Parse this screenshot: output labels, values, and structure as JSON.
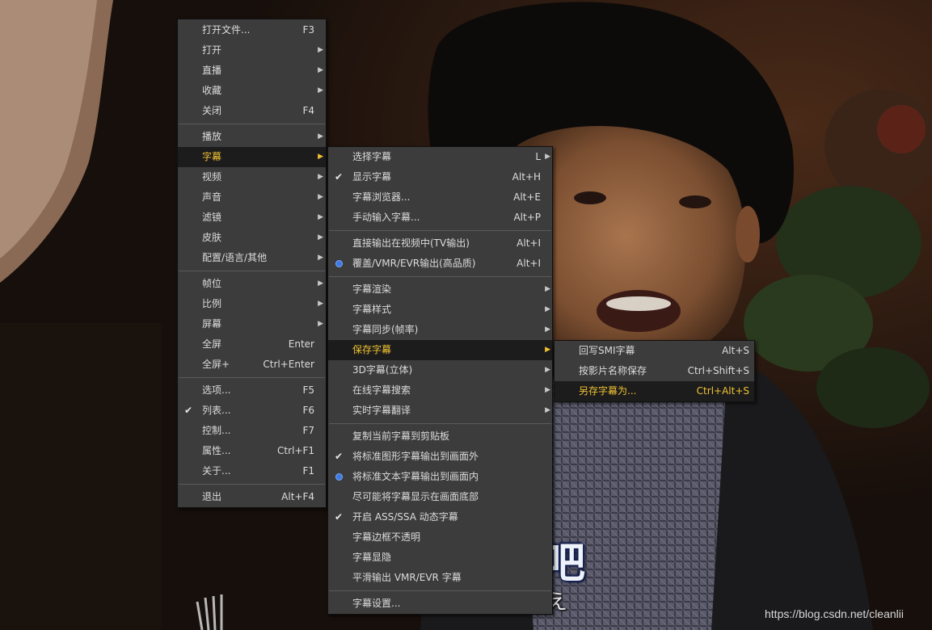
{
  "menu_main": {
    "items": [
      {
        "label": "打开文件...",
        "shortcut": "F3"
      },
      {
        "label": "打开",
        "submenu": true
      },
      {
        "label": "直播",
        "submenu": true
      },
      {
        "label": "收藏",
        "submenu": true
      },
      {
        "label": "关闭",
        "shortcut": "F4"
      },
      {
        "label": "播放",
        "submenu": true
      },
      {
        "label": "字幕",
        "submenu": true,
        "active": true
      },
      {
        "label": "视频",
        "submenu": true
      },
      {
        "label": "声音",
        "submenu": true
      },
      {
        "label": "滤镜",
        "submenu": true
      },
      {
        "label": "皮肤",
        "submenu": true
      },
      {
        "label": "配置/语言/其他",
        "submenu": true
      },
      {
        "label": "帧位",
        "submenu": true
      },
      {
        "label": "比例",
        "submenu": true
      },
      {
        "label": "屏幕",
        "submenu": true
      },
      {
        "label": "全屏",
        "shortcut": "Enter"
      },
      {
        "label": "全屏+",
        "shortcut": "Ctrl+Enter"
      },
      {
        "label": "选项...",
        "shortcut": "F5"
      },
      {
        "label": "列表...",
        "shortcut": "F6",
        "checked": true
      },
      {
        "label": "控制...",
        "shortcut": "F7"
      },
      {
        "label": "属性...",
        "shortcut": "Ctrl+F1"
      },
      {
        "label": "关于...",
        "shortcut": "F1"
      },
      {
        "label": "退出",
        "shortcut": "Alt+F4"
      }
    ]
  },
  "menu_subtitle": {
    "items": [
      {
        "label": "选择字幕",
        "shortcut": "L",
        "submenu": true
      },
      {
        "label": "显示字幕",
        "shortcut": "Alt+H",
        "checked": true
      },
      {
        "label": "字幕浏览器...",
        "shortcut": "Alt+E"
      },
      {
        "label": "手动输入字幕...",
        "shortcut": "Alt+P"
      },
      {
        "label": "直接输出在视频中(TV输出)",
        "shortcut": "Alt+I"
      },
      {
        "label": "覆盖/VMR/EVR输出(高品质)",
        "shortcut": "Alt+I",
        "radio": true
      },
      {
        "label": "字幕渲染",
        "submenu": true
      },
      {
        "label": "字幕样式",
        "submenu": true
      },
      {
        "label": "字幕同步(帧率)",
        "submenu": true
      },
      {
        "label": "保存字幕",
        "submenu": true,
        "active": true
      },
      {
        "label": "3D字幕(立体)",
        "submenu": true
      },
      {
        "label": "在线字幕搜索",
        "submenu": true
      },
      {
        "label": "实时字幕翻译",
        "submenu": true
      },
      {
        "label": "复制当前字幕到剪贴板"
      },
      {
        "label": "将标准图形字幕输出到画面外",
        "checked": true
      },
      {
        "label": "将标准文本字幕输出到画面内",
        "radio": true
      },
      {
        "label": "尽可能将字幕显示在画面底部"
      },
      {
        "label": "开启 ASS/SSA 动态字幕",
        "checked": true
      },
      {
        "label": "字幕边框不透明"
      },
      {
        "label": "字幕显隐"
      },
      {
        "label": "平滑输出 VMR/EVR 字幕"
      },
      {
        "label": "字幕设置..."
      }
    ]
  },
  "menu_save": {
    "items": [
      {
        "label": "回写SMI字幕",
        "shortcut": "Alt+S"
      },
      {
        "label": "按影片名称保存",
        "shortcut": "Ctrl+Shift+S"
      },
      {
        "label": "另存字幕为...",
        "shortcut": "Ctrl+Alt+S",
        "active": true
      }
    ]
  },
  "subtitle": {
    "line1": "吧",
    "line2": "え"
  },
  "watermark": "https://blog.csdn.net/cleanlii",
  "colors": {
    "accent": "#f1c232",
    "menu_bg": "#3c3c3c",
    "highlight_bg": "#1c1c1c",
    "radio": "#3f7ae0"
  }
}
